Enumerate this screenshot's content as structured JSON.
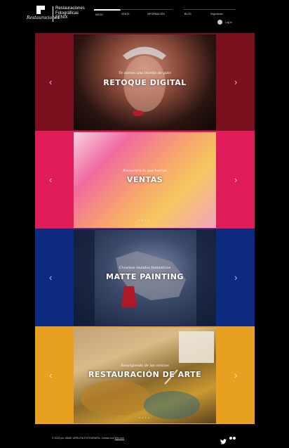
{
  "header": {
    "logo_script": "Restauraciones",
    "logo_lines": [
      "Restauraciones",
      "Fotográficas",
      "FENIX"
    ],
    "nav": [
      {
        "label": "INICIO"
      },
      {
        "label": "VENTA"
      },
      {
        "label": "INFORMACIÓN"
      },
      {
        "label": "BLOG"
      },
      {
        "label": "Seguidores"
      }
    ],
    "login_label": "Log In"
  },
  "slides": [
    {
      "tagline": "Te damos una manita de gato",
      "title": "RETOQUE DIGITAL"
    },
    {
      "tagline": "Encuentra lo que buscas",
      "title": "VENTAS"
    },
    {
      "tagline": "Creamos mundos fantásticos",
      "title": "MATTE PAINTING"
    },
    {
      "tagline": "Resurgiendo de las cenizas",
      "title": "RESTAURACIÓN DE ARTE"
    }
  ],
  "icons": {
    "prev": "chevron-left-icon",
    "next": "chevron-right-icon"
  },
  "colors": {
    "slide1_bg": "#7a0f1e",
    "slide2_bg": "#e01d58",
    "slide3_bg": "#0c2a80",
    "slide4_bg": "#e8a020"
  },
  "footer": {
    "text": "© 2023 por JAIME URRUTIA FOTOGRAFÍA. Creado con",
    "link": "Wix.com"
  }
}
